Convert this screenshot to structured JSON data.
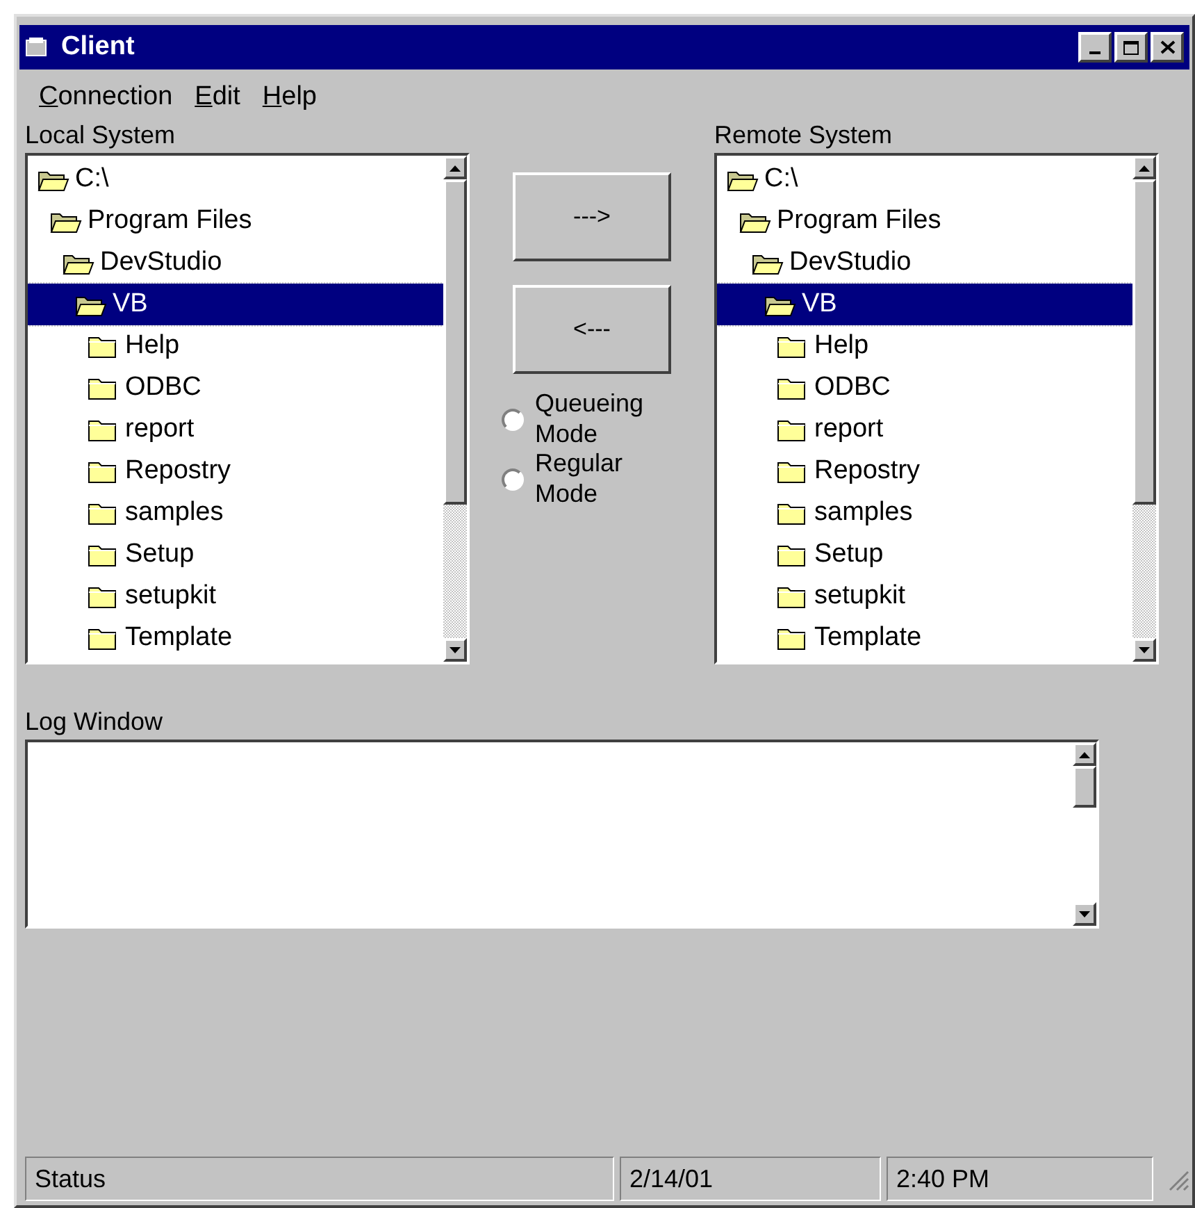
{
  "window": {
    "title": "Client"
  },
  "menu": [
    {
      "label": "Connection"
    },
    {
      "label": "Edit"
    },
    {
      "label": "Help"
    }
  ],
  "local_system": {
    "label": "Local System",
    "tree": [
      {
        "label": "C:\\",
        "expanded": true,
        "selected": false,
        "children": [
          {
            "label": "Program Files",
            "expanded": true,
            "selected": false,
            "children": [
              {
                "label": "DevStudio",
                "expanded": true,
                "selected": false,
                "children": [
                  {
                    "label": "VB",
                    "expanded": true,
                    "selected": true,
                    "children": [
                      {
                        "label": "Help",
                        "expanded": false,
                        "selected": false
                      },
                      {
                        "label": "ODBC",
                        "expanded": false,
                        "selected": false
                      },
                      {
                        "label": "report",
                        "expanded": false,
                        "selected": false
                      },
                      {
                        "label": "Repostry",
                        "expanded": false,
                        "selected": false
                      },
                      {
                        "label": "samples",
                        "expanded": false,
                        "selected": false
                      },
                      {
                        "label": "Setup",
                        "expanded": false,
                        "selected": false
                      },
                      {
                        "label": "setupkit",
                        "expanded": false,
                        "selected": false
                      },
                      {
                        "label": "Template",
                        "expanded": false,
                        "selected": false
                      }
                    ]
                  }
                ]
              }
            ]
          }
        ]
      }
    ]
  },
  "transfer_buttons": [
    {
      "label": "--->"
    },
    {
      "label": "<---"
    }
  ],
  "modes": [
    {
      "label": "Queueing Mode",
      "selected": false
    },
    {
      "label": "Regular Mode",
      "selected": false
    }
  ],
  "remote_system": {
    "label": "Remote System",
    "tree": [
      {
        "label": "C:\\",
        "expanded": true,
        "selected": false,
        "children": [
          {
            "label": "Program Files",
            "expanded": true,
            "selected": false,
            "children": [
              {
                "label": "DevStudio",
                "expanded": true,
                "selected": false,
                "children": [
                  {
                    "label": "VB",
                    "expanded": true,
                    "selected": true,
                    "children": [
                      {
                        "label": "Help",
                        "expanded": false,
                        "selected": false
                      },
                      {
                        "label": "ODBC",
                        "expanded": false,
                        "selected": false
                      },
                      {
                        "label": "report",
                        "expanded": false,
                        "selected": false
                      },
                      {
                        "label": "Repostry",
                        "expanded": false,
                        "selected": false
                      },
                      {
                        "label": "samples",
                        "expanded": false,
                        "selected": false
                      },
                      {
                        "label": "Setup",
                        "expanded": false,
                        "selected": false
                      },
                      {
                        "label": "setupkit",
                        "expanded": false,
                        "selected": false
                      },
                      {
                        "label": "Template",
                        "expanded": false,
                        "selected": false
                      }
                    ]
                  }
                ]
              }
            ]
          }
        ]
      }
    ]
  },
  "log_window": {
    "label": "Log Window"
  },
  "status_bar": [
    {
      "text": "Status"
    },
    {
      "text": "2/14/01"
    },
    {
      "text": "2:40 PM"
    }
  ]
}
